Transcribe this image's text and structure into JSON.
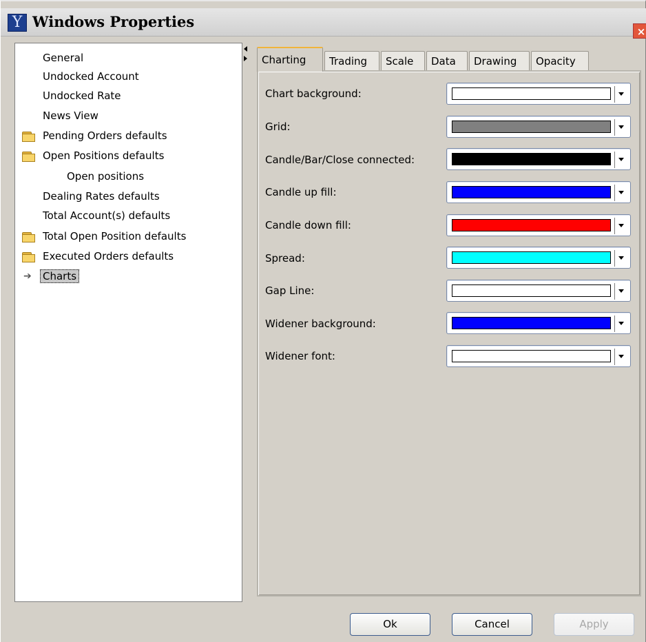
{
  "window": {
    "title": "Windows Properties",
    "icon": "Y"
  },
  "tree": {
    "items": [
      {
        "label": "General",
        "folder": false
      },
      {
        "label": "Undocked Account",
        "folder": false
      },
      {
        "label": "Undocked Rate",
        "folder": false
      },
      {
        "label": "News View",
        "folder": false
      },
      {
        "label": "Pending Orders defaults",
        "folder": true
      },
      {
        "label": "Open Positions defaults",
        "folder": true
      },
      {
        "label": "Open positions",
        "folder": false
      },
      {
        "label": "Dealing Rates defaults",
        "folder": false
      },
      {
        "label": "Total Account(s) defaults",
        "folder": false
      },
      {
        "label": "Total Open Position defaults",
        "folder": true
      },
      {
        "label": "Executed Orders defaults",
        "folder": true
      },
      {
        "label": "Charts",
        "folder": false,
        "selected": true
      }
    ]
  },
  "tabs": [
    {
      "label": "Charting",
      "active": true
    },
    {
      "label": "Trading"
    },
    {
      "label": "Scale"
    },
    {
      "label": "Data"
    },
    {
      "label": "Drawing"
    },
    {
      "label": "Opacity"
    }
  ],
  "settings": [
    {
      "label": "Chart background:",
      "color": "#ffffff"
    },
    {
      "label": "Grid:",
      "color": "#808080"
    },
    {
      "label": "Candle/Bar/Close connected:",
      "color": "#000000"
    },
    {
      "label": "Candle up fill:",
      "color": "#0000ff"
    },
    {
      "label": "Candle down fill:",
      "color": "#ff0000"
    },
    {
      "label": "Spread:",
      "color": "#00ffff"
    },
    {
      "label": "Gap Line:",
      "color": "#ffffff"
    },
    {
      "label": "Widener background:",
      "color": "#0000ff"
    },
    {
      "label": "Widener font:",
      "color": "#ffffff"
    }
  ],
  "buttons": {
    "ok": "Ok",
    "cancel": "Cancel",
    "apply": "Apply"
  },
  "close_glyph": "×"
}
